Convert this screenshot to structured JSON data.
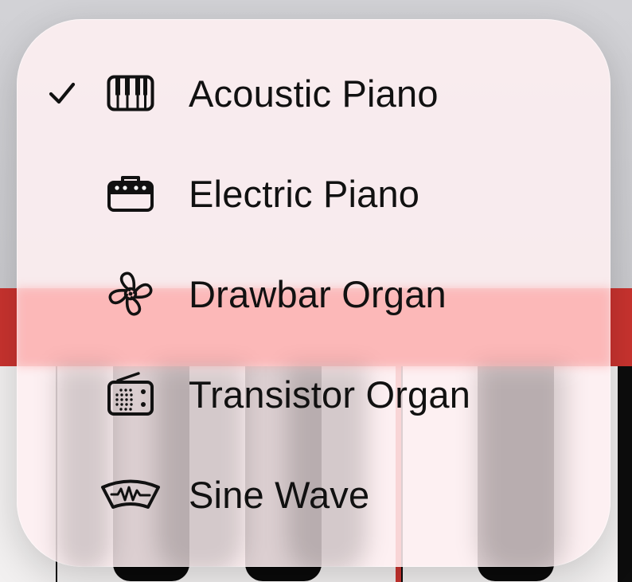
{
  "colors": {
    "accent_red": "#c9332f",
    "menu_background": "#fff0f2",
    "text": "#111111",
    "keyboard_black": "#0a0a0a",
    "keyboard_white": "#f2f0f0"
  },
  "instrument_menu": {
    "selected_index": 0,
    "items": [
      {
        "label": "Acoustic Piano",
        "icon": "piano-keys-icon",
        "selected": true
      },
      {
        "label": "Electric Piano",
        "icon": "amplifier-icon",
        "selected": false
      },
      {
        "label": "Drawbar Organ",
        "icon": "fan-icon",
        "selected": false
      },
      {
        "label": "Transistor Organ",
        "icon": "radio-icon",
        "selected": false
      },
      {
        "label": "Sine Wave",
        "icon": "waveform-dial-icon",
        "selected": false
      }
    ]
  }
}
